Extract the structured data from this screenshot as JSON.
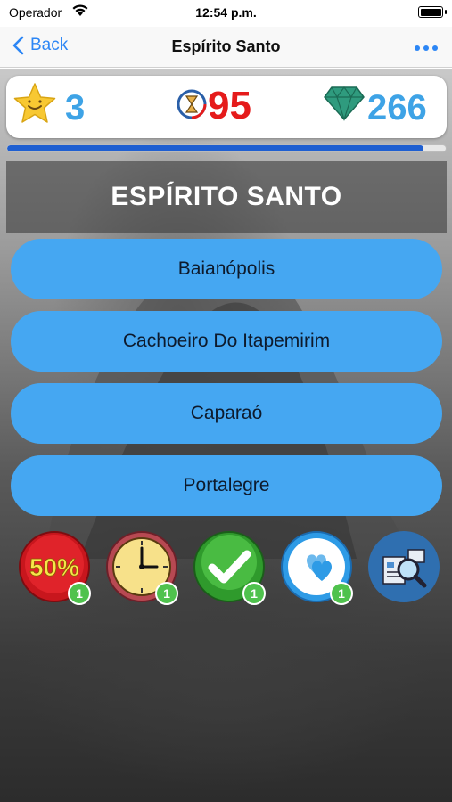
{
  "status_bar": {
    "carrier": "Operador",
    "time": "12:54 p.m."
  },
  "nav": {
    "back_label": "Back",
    "title": "Espírito Santo"
  },
  "hud": {
    "stars": "3",
    "timer": "95",
    "gems": "266"
  },
  "progress": {
    "fraction": 0.95
  },
  "question": {
    "text": "ESPÍRITO SANTO"
  },
  "answers": [
    {
      "label": "Baianópolis"
    },
    {
      "label": "Cachoeiro Do Itapemirim"
    },
    {
      "label": "Caparaó"
    },
    {
      "label": "Portalegre"
    }
  ],
  "powerups": [
    {
      "icon": "fifty-percent-icon",
      "label": "50%",
      "count": "1"
    },
    {
      "icon": "clock-icon",
      "count": "1"
    },
    {
      "icon": "checkmark-icon",
      "count": "1"
    },
    {
      "icon": "hearts-icon",
      "count": "1"
    },
    {
      "icon": "magnifier-icon"
    }
  ],
  "colors": {
    "accent": "#2c86f5",
    "answer_bg": "#45a7f2",
    "timer": "#e51b1b",
    "counter": "#3ea3e6"
  }
}
